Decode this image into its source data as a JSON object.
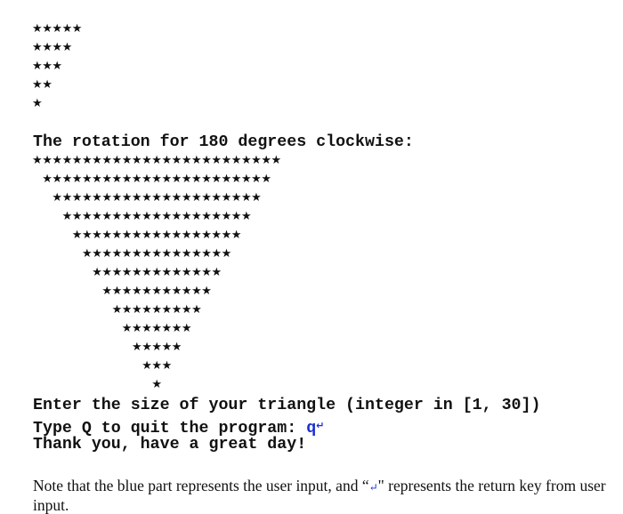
{
  "small_triangle": {
    "star_glyph": "★",
    "rows": [
      5,
      4,
      3,
      2,
      1
    ]
  },
  "rotation_heading": "The rotation for 180 degrees clockwise:",
  "big_triangle": {
    "star_glyph": "★",
    "rows": [
      25,
      23,
      21,
      19,
      17,
      15,
      13,
      11,
      9,
      7,
      5,
      3,
      1
    ]
  },
  "console": {
    "prompt_size": "Enter the size of your triangle (integer in [1, 30])",
    "prompt_quit": "Type Q to quit the program: ",
    "user_input": "q",
    "return_symbol": "↵",
    "farewell": "Thank you, have a great day!"
  },
  "note": {
    "part1": "Note that the blue part represents the user input, and  “",
    "return_symbol": "↵",
    "part2": "\" represents the return key from user input."
  },
  "colors": {
    "user_input": "#1a2fd0",
    "text": "#111111"
  }
}
